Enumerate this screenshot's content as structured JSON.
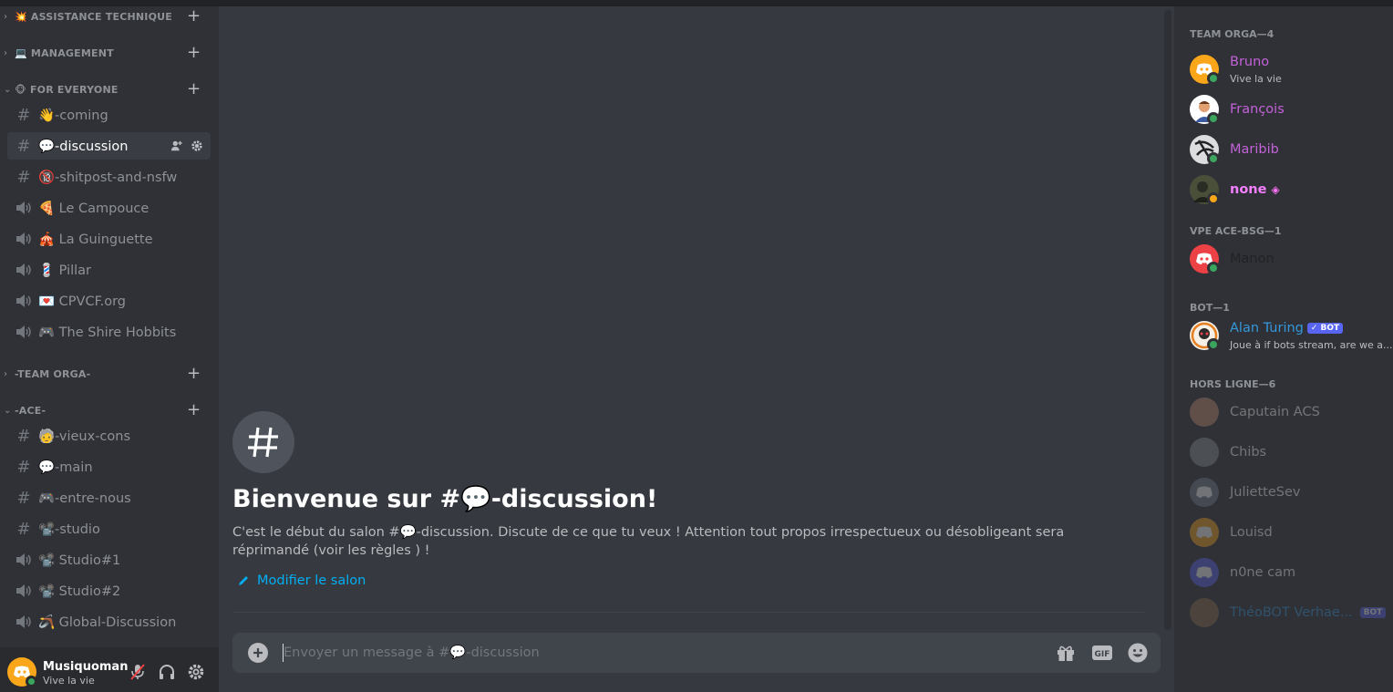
{
  "sidebar": {
    "categories": [
      {
        "label": "💥 ASSISTANCE TECHNIQUE"
      },
      {
        "label": "💻 MANAGEMENT"
      },
      {
        "label": "🐵 FOR EVERYONE"
      },
      {
        "label": "-TEAM ORGA-"
      },
      {
        "label": "-ACE-"
      }
    ],
    "channels": [
      {
        "type": "text",
        "name": "👋-coming"
      },
      {
        "type": "text",
        "name": "💬-discussion"
      },
      {
        "type": "text",
        "name": "🔞-shitpost-and-nsfw"
      },
      {
        "type": "voice",
        "name": "🍕 Le Campouce"
      },
      {
        "type": "voice",
        "name": "🎪 La Guinguette"
      },
      {
        "type": "voice",
        "name": "💈 Pillar"
      },
      {
        "type": "voice",
        "name": "💌 CPVCF.org"
      },
      {
        "type": "voice",
        "name": "🎮 The Shire Hobbits"
      },
      {
        "type": "text",
        "name": "🧓-vieux-cons"
      },
      {
        "type": "text",
        "name": "💬-main"
      },
      {
        "type": "text",
        "name": "🎮-entre-nous"
      },
      {
        "type": "text",
        "name": "📽️-studio"
      },
      {
        "type": "voice",
        "name": "📽️ Studio#1"
      },
      {
        "type": "voice",
        "name": "📽️ Studio#2"
      },
      {
        "type": "voice",
        "name": "🪃 Global-Discussion"
      }
    ],
    "active_channel": "💬-discussion"
  },
  "user": {
    "name": "Musiquoman",
    "status": "Vive la vie"
  },
  "main": {
    "welcome_prefix": "Bienvenue sur #",
    "welcome_channel": "💬-discussion",
    "welcome_suffix": "!",
    "description": "C'est le début du salon #💬-discussion. Discute de ce que tu veux ! Attention tout propos irrespectueux ou désobligeant sera réprimandé (voir les règles ) !",
    "edit_label": "Modifier le salon",
    "composer_placeholder": "Envoyer un message à #💬-discussion"
  },
  "members": {
    "groups": [
      {
        "header": "TEAM ORGA—4"
      },
      {
        "header": "VPE ACE-BSG—1"
      },
      {
        "header": "BOT—1"
      },
      {
        "header": "HORS LIGNE—6"
      }
    ],
    "list": [
      {
        "name": "Bruno",
        "sub": "Vive la vie",
        "color": "#c462d9",
        "status": "online"
      },
      {
        "name": "François",
        "sub": "",
        "color": "#c462d9",
        "status": "online"
      },
      {
        "name": "Maribib",
        "sub": "",
        "color": "#c462d9",
        "status": "online"
      },
      {
        "name": "none",
        "sub": "",
        "color": "#f47fff",
        "status": "idle"
      },
      {
        "name": "Manon",
        "sub": "",
        "color": "#202225",
        "status": "online"
      },
      {
        "name": "Alan Turing",
        "sub": "Joue à if bots stream, are we a...",
        "color": "#3498db",
        "status": "online",
        "tag": "✓ BOT"
      },
      {
        "name": "Caputain ACS",
        "sub": "",
        "color": "#ffffff",
        "status": "offline"
      },
      {
        "name": "Chibs",
        "sub": "",
        "color": "#ffffff",
        "status": "offline"
      },
      {
        "name": "JulietteSev",
        "sub": "",
        "color": "#ffffff",
        "status": "offline"
      },
      {
        "name": "Louisd",
        "sub": "",
        "color": "#ffffff",
        "status": "offline"
      },
      {
        "name": "n0ne cam",
        "sub": "",
        "color": "#ffffff",
        "status": "offline"
      },
      {
        "name": "ThéoBOT Verhae...",
        "sub": "",
        "color": "#3498db",
        "status": "offline",
        "tag": "BOT"
      }
    ]
  },
  "colors": {
    "accent": "#5865f2",
    "link": "#00b0f4",
    "online": "#3ba55d",
    "idle": "#faa61a"
  },
  "icons": {
    "text_channel": "hash-icon",
    "voice_channel": "speaker-icon",
    "add_member": "add-member-icon",
    "settings": "gear-icon"
  }
}
